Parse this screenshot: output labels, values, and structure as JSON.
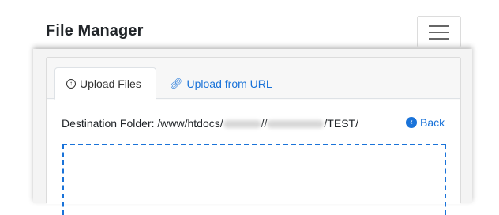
{
  "navbar": {
    "brand": "File Manager"
  },
  "tabs": [
    {
      "label": "Upload Files",
      "icon": "circle-arrow-up-icon",
      "active": true
    },
    {
      "label": "Upload from URL",
      "icon": "link-icon",
      "active": false
    }
  ],
  "destination": {
    "prefix": "Destination Folder: /www/htdocs/",
    "sep1": "//",
    "suffix": "/TEST/"
  },
  "back": {
    "label": "Back",
    "icon": "chevron-left-circle-icon"
  },
  "colors": {
    "accent": "#1a73d9",
    "text": "#212529"
  }
}
